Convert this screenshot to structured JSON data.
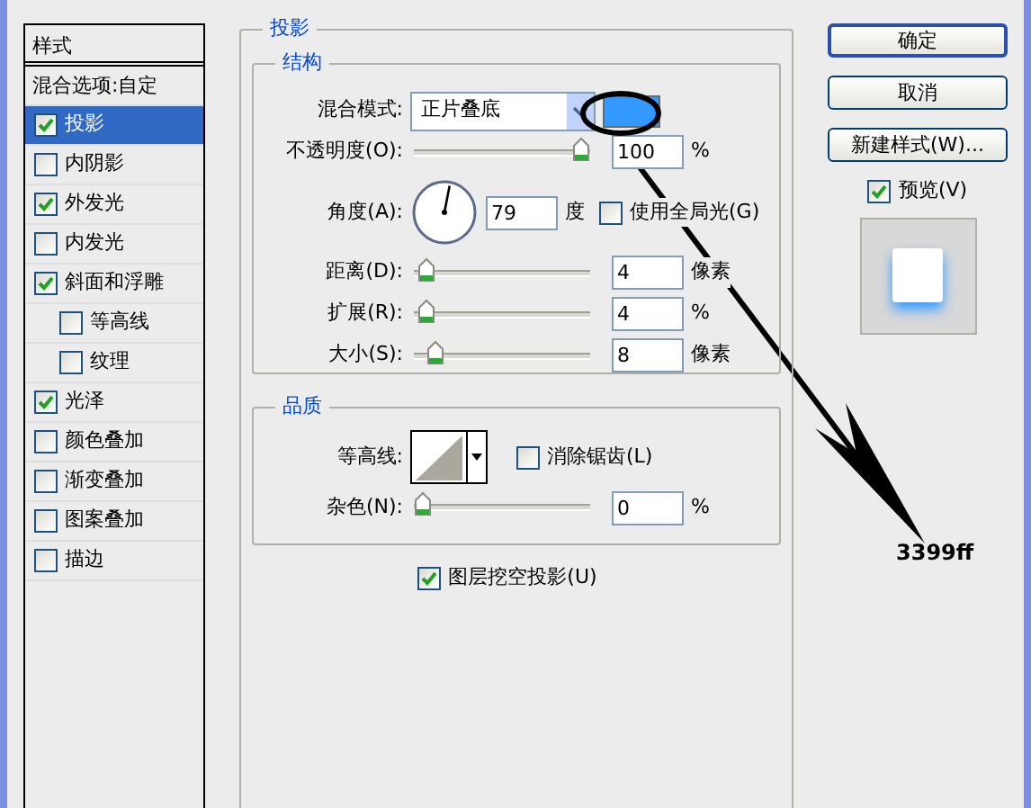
{
  "sidebar": {
    "header": "样式",
    "blend_options": "混合选项:自定",
    "items": [
      {
        "label": "投影",
        "checked": true,
        "selected": true
      },
      {
        "label": "内阴影",
        "checked": false,
        "selected": false
      },
      {
        "label": "外发光",
        "checked": true,
        "selected": false
      },
      {
        "label": "内发光",
        "checked": false,
        "selected": false
      },
      {
        "label": "斜面和浮雕",
        "checked": true,
        "selected": false,
        "children": [
          {
            "label": "等高线",
            "checked": false,
            "selected": false
          },
          {
            "label": "纹理",
            "checked": false,
            "selected": false
          }
        ]
      },
      {
        "label": "光泽",
        "checked": true,
        "selected": false
      },
      {
        "label": "颜色叠加",
        "checked": false,
        "selected": false
      },
      {
        "label": "渐变叠加",
        "checked": false,
        "selected": false
      },
      {
        "label": "图案叠加",
        "checked": false,
        "selected": false
      },
      {
        "label": "描边",
        "checked": false,
        "selected": false
      }
    ]
  },
  "panel": {
    "title": "投影",
    "structure": {
      "title": "结构",
      "blend_mode": {
        "label": "混合模式:",
        "value": "正片叠底",
        "color": "#3399ff"
      },
      "rows": [
        {
          "kind": "slider",
          "label": "不透明度(O):",
          "level": 1,
          "value": "100",
          "unit": "%"
        },
        {
          "kind": "angle",
          "label": "角度(A):",
          "value": "79",
          "unit": "度",
          "global_light": {
            "label": "使用全局光(G)",
            "checked": false
          }
        },
        {
          "kind": "slider",
          "label": "距离(D):",
          "level": 0.02,
          "value": "4",
          "unit": "像素"
        },
        {
          "kind": "slider",
          "label": "扩展(R):",
          "level": 0.02,
          "value": "4",
          "unit": "%"
        },
        {
          "kind": "slider",
          "label": "大小(S):",
          "level": 0.08,
          "value": "8",
          "unit": "像素"
        }
      ]
    },
    "quality": {
      "title": "品质",
      "contour": {
        "label": "等高线:"
      },
      "anti_alias": {
        "label": "消除锯齿(L)",
        "checked": false
      },
      "noise": {
        "label": "杂色(N):",
        "level": 0,
        "value": "0",
        "unit": "%"
      }
    },
    "knockout": {
      "label": "图层挖空投影(U)",
      "checked": true
    }
  },
  "buttons": [
    {
      "label": "确定",
      "default": true
    },
    {
      "label": "取消",
      "default": false
    },
    {
      "label": "新建样式(W)...",
      "default": false
    }
  ],
  "preview": {
    "label": "预览(V)",
    "checked": true
  },
  "annotation": {
    "text": "3399ff"
  }
}
